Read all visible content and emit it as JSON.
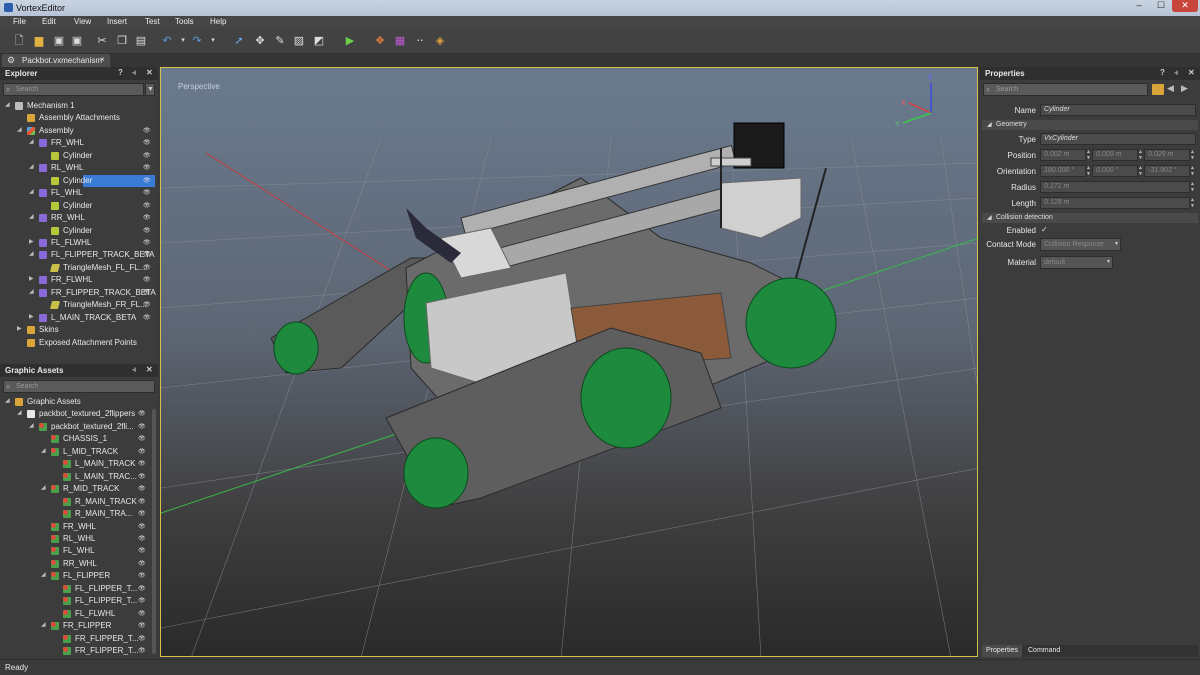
{
  "window": {
    "title": "VortexEditor",
    "controls": {
      "minimize": "–",
      "maximize": "☐",
      "close": "✕"
    }
  },
  "menu": [
    "File",
    "Edit",
    "View",
    "Insert",
    "Test",
    "Tools",
    "Help"
  ],
  "toolbar": {
    "icons": [
      "new-document-icon",
      "open-folder-icon",
      "save-icon",
      "save-all-icon",
      "cut-icon",
      "copy-icon",
      "paste-icon",
      "undo-icon",
      "redo-icon",
      "select-arrow-icon",
      "move-icon",
      "ruler-icon",
      "image-icon",
      "graph-icon",
      "play-icon",
      "cubes-icon",
      "palette-icon",
      "dots-icon",
      "paint-icon"
    ]
  },
  "doc_tab": {
    "label": "Packbot.vxmechanism",
    "close": "×"
  },
  "explorer": {
    "title": "Explorer",
    "header_icons": {
      "help": "?",
      "pin": "⫞",
      "close": "✕"
    },
    "search_placeholder": "Search",
    "tree": [
      {
        "label": "Mechanism 1",
        "depth": 0,
        "arrow": "◢",
        "icon": "ic-gear",
        "eye": false
      },
      {
        "label": "Assembly Attachments",
        "depth": 1,
        "arrow": "",
        "icon": "ic-folder",
        "eye": false
      },
      {
        "label": "Assembly",
        "depth": 1,
        "arrow": "◢",
        "icon": "ic-assembly",
        "eye": true
      },
      {
        "label": "FR_WHL",
        "depth": 2,
        "arrow": "◢",
        "icon": "ic-part",
        "eye": true
      },
      {
        "label": "Cylinder",
        "depth": 3,
        "arrow": "",
        "icon": "ic-cyl",
        "eye": true
      },
      {
        "label": "RL_WHL",
        "depth": 2,
        "arrow": "◢",
        "icon": "ic-part",
        "eye": true
      },
      {
        "label": "Cylinder",
        "depth": 3,
        "arrow": "",
        "icon": "ic-cyl",
        "eye": true,
        "selected": true
      },
      {
        "label": "FL_WHL",
        "depth": 2,
        "arrow": "◢",
        "icon": "ic-part",
        "eye": true
      },
      {
        "label": "Cylinder",
        "depth": 3,
        "arrow": "",
        "icon": "ic-cyl",
        "eye": true
      },
      {
        "label": "RR_WHL",
        "depth": 2,
        "arrow": "◢",
        "icon": "ic-part",
        "eye": true
      },
      {
        "label": "Cylinder",
        "depth": 3,
        "arrow": "",
        "icon": "ic-cyl",
        "eye": true
      },
      {
        "label": "FL_FLWHL",
        "depth": 2,
        "arrow": "▶",
        "icon": "ic-part",
        "eye": true
      },
      {
        "label": "FL_FLIPPER_TRACK_BETA",
        "depth": 2,
        "arrow": "◢",
        "icon": "ic-part",
        "eye": true
      },
      {
        "label": "TriangleMesh_FL_FL...",
        "depth": 3,
        "arrow": "",
        "icon": "ic-mesh",
        "eye": true
      },
      {
        "label": "FR_FLWHL",
        "depth": 2,
        "arrow": "▶",
        "icon": "ic-part",
        "eye": true
      },
      {
        "label": "FR_FLIPPER_TRACK_BETA",
        "depth": 2,
        "arrow": "◢",
        "icon": "ic-part",
        "eye": true
      },
      {
        "label": "TriangleMesh_FR_FL...",
        "depth": 3,
        "arrow": "",
        "icon": "ic-mesh",
        "eye": true
      },
      {
        "label": "L_MAIN_TRACK_BETA",
        "depth": 2,
        "arrow": "▶",
        "icon": "ic-part",
        "eye": true
      },
      {
        "label": "Skins",
        "depth": 1,
        "arrow": "▶",
        "icon": "ic-folder",
        "eye": false
      },
      {
        "label": "Exposed Attachment Points",
        "depth": 1,
        "arrow": "",
        "icon": "ic-folder",
        "eye": false
      }
    ]
  },
  "graphic_assets": {
    "title": "Graphic Assets",
    "header_icons": {
      "pin": "⫞",
      "close": "✕"
    },
    "search_placeholder": "Search",
    "tree": [
      {
        "label": "Graphic Assets",
        "depth": 0,
        "arrow": "◢",
        "icon": "ic-folder"
      },
      {
        "label": "packbot_textured_2flippers",
        "depth": 1,
        "arrow": "◢",
        "icon": "ic-doc"
      },
      {
        "label": "packbot_textured_2fli...",
        "depth": 2,
        "arrow": "◢",
        "icon": "ic-node"
      },
      {
        "label": "CHASSIS_1",
        "depth": 3,
        "arrow": "",
        "icon": "ic-node"
      },
      {
        "label": "L_MID_TRACK",
        "depth": 3,
        "arrow": "◢",
        "icon": "ic-node"
      },
      {
        "label": "L_MAIN_TRACK",
        "depth": 4,
        "arrow": "",
        "icon": "ic-node"
      },
      {
        "label": "L_MAIN_TRAC...",
        "depth": 4,
        "arrow": "",
        "icon": "ic-node"
      },
      {
        "label": "R_MID_TRACK",
        "depth": 3,
        "arrow": "◢",
        "icon": "ic-node"
      },
      {
        "label": "R_MAIN_TRACK",
        "depth": 4,
        "arrow": "",
        "icon": "ic-node"
      },
      {
        "label": "R_MAIN_TRA...",
        "depth": 4,
        "arrow": "",
        "icon": "ic-node"
      },
      {
        "label": "FR_WHL",
        "depth": 3,
        "arrow": "",
        "icon": "ic-node"
      },
      {
        "label": "RL_WHL",
        "depth": 3,
        "arrow": "",
        "icon": "ic-node"
      },
      {
        "label": "FL_WHL",
        "depth": 3,
        "arrow": "",
        "icon": "ic-node"
      },
      {
        "label": "RR_WHL",
        "depth": 3,
        "arrow": "",
        "icon": "ic-node"
      },
      {
        "label": "FL_FLIPPER",
        "depth": 3,
        "arrow": "◢",
        "icon": "ic-node"
      },
      {
        "label": "FL_FLIPPER_T...",
        "depth": 4,
        "arrow": "",
        "icon": "ic-node"
      },
      {
        "label": "FL_FLIPPER_T...",
        "depth": 4,
        "arrow": "",
        "icon": "ic-node"
      },
      {
        "label": "FL_FLWHL",
        "depth": 4,
        "arrow": "",
        "icon": "ic-node"
      },
      {
        "label": "FR_FLIPPER",
        "depth": 3,
        "arrow": "◢",
        "icon": "ic-node"
      },
      {
        "label": "FR_FLIPPER_T...",
        "depth": 4,
        "arrow": "",
        "icon": "ic-node"
      },
      {
        "label": "FR_FLIPPER_T...",
        "depth": 4,
        "arrow": "",
        "icon": "ic-node"
      }
    ]
  },
  "viewport": {
    "label": "Perspective",
    "axes": {
      "x": "X",
      "y": "Y",
      "z": "Z"
    }
  },
  "properties": {
    "title": "Properties",
    "header_icons": {
      "help": "?",
      "pin": "⫞",
      "close": "✕"
    },
    "search_placeholder": "Search",
    "name_label": "Name",
    "name_value": "Cylinder",
    "sections": {
      "geometry": "Geometry",
      "collision": "Collision detection"
    },
    "type_label": "Type",
    "type_value": "VxCylinder",
    "position_label": "Position",
    "position": [
      "0.002 m",
      "0.009 m",
      "0.029 m"
    ],
    "orientation_label": "Orientation",
    "orientation": [
      "180.000 °",
      "0.000 °",
      "-31.903 °"
    ],
    "radius_label": "Radius",
    "radius": "0.171 m",
    "length_label": "Length",
    "length": "0.128 m",
    "enabled_label": "Enabled",
    "enabled_check": "✓",
    "contact_mode_label": "Contact Mode",
    "contact_mode_value": "Collision Response",
    "material_label": "Material",
    "material_value": "default",
    "bottom_tabs": [
      "Properties",
      "Command"
    ]
  },
  "status": {
    "text": "Ready"
  },
  "colors": {
    "selection": "#3a7bd5",
    "viewport_border": "#d4c04a",
    "track_green": "#1e8a3e"
  }
}
